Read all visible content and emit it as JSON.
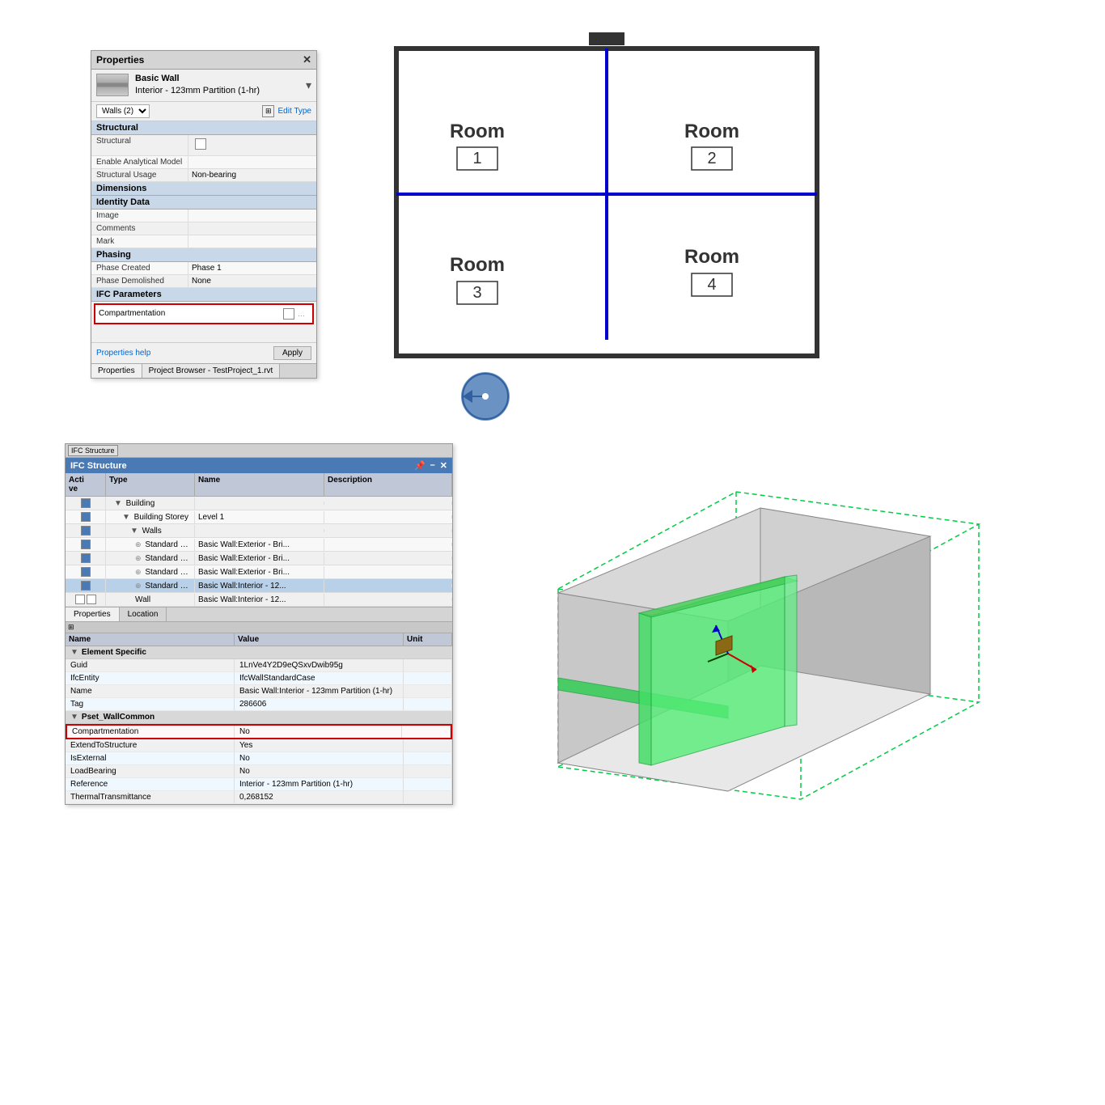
{
  "properties_panel": {
    "title": "Properties",
    "close_btn": "✕",
    "wall_name": "Basic Wall",
    "wall_subtype": "Interior - 123mm Partition (1-hr)",
    "walls_label": "Walls (2)",
    "edit_type_label": "Edit Type",
    "sections": {
      "structural": {
        "header": "Structural",
        "rows": [
          {
            "name": "Structural",
            "value": "checkbox"
          },
          {
            "name": "Enable Analytical Model",
            "value": ""
          },
          {
            "name": "Structural Usage",
            "value": "Non-bearing"
          }
        ]
      },
      "dimensions": {
        "header": "Dimensions"
      },
      "identity_data": {
        "header": "Identity Data",
        "rows": [
          {
            "name": "Image",
            "value": ""
          },
          {
            "name": "Comments",
            "value": ""
          },
          {
            "name": "Mark",
            "value": ""
          }
        ]
      },
      "phasing": {
        "header": "Phasing",
        "rows": [
          {
            "name": "Phase Created",
            "value": "Phase 1"
          },
          {
            "name": "Phase Demolished",
            "value": "None"
          }
        ]
      },
      "ifc_parameters": {
        "header": "IFC Parameters",
        "rows": [
          {
            "name": "Compartmentation",
            "value": "checkbox",
            "highlighted": true
          }
        ]
      }
    },
    "footer": {
      "help_link": "Properties help",
      "apply_btn": "Apply"
    },
    "tabs": [
      "Properties",
      "Project Browser - TestProject_1.rvt"
    ]
  },
  "floor_plan": {
    "rooms": [
      {
        "label": "Room",
        "number": "1"
      },
      {
        "label": "Room",
        "number": "2"
      },
      {
        "label": "Room",
        "number": "3"
      },
      {
        "label": "Room",
        "number": "4"
      }
    ]
  },
  "ifc_structure": {
    "title": "IFC Structure",
    "panel_label": "IFC Structure",
    "table_headers": [
      "Active",
      "Type",
      "Name",
      "Description"
    ],
    "rows": [
      {
        "active": true,
        "indent": 0,
        "type": "Building",
        "name": "",
        "description": ""
      },
      {
        "active": true,
        "indent": 1,
        "type": "Building Storey",
        "name": "Level 1",
        "description": ""
      },
      {
        "active": true,
        "indent": 2,
        "type": "Walls",
        "name": "",
        "description": ""
      },
      {
        "active": true,
        "indent": 3,
        "type": "Standard Wall",
        "name": "Basic Wall:Exterior - Bri...",
        "description": ""
      },
      {
        "active": true,
        "indent": 3,
        "type": "Standard Wall",
        "name": "Basic Wall:Exterior - Bri...",
        "description": ""
      },
      {
        "active": true,
        "indent": 3,
        "type": "Standard Wall",
        "name": "Basic Wall:Exterior - Bri...",
        "description": ""
      },
      {
        "active": true,
        "indent": 3,
        "type": "Standard Wall",
        "name": "Basic Wall:Interior - 12...",
        "description": "",
        "selected": true
      },
      {
        "active": true,
        "indent": 3,
        "type": "Wall",
        "name": "Basic Wall:Interior - 12...",
        "description": ""
      }
    ],
    "bottom_tabs": [
      "Properties",
      "Location"
    ],
    "props_headers": [
      "Name",
      "Value",
      "Unit"
    ],
    "prop_sections": [
      {
        "name": "Element Specific",
        "rows": [
          {
            "name": "Guid",
            "value": "1LnVe4Y2D9eQSxvDwib95g",
            "unit": ""
          },
          {
            "name": "IfcEntity",
            "value": "IfcWallStandardCase",
            "unit": ""
          },
          {
            "name": "Name",
            "value": "Basic Wall:Interior - 123mm Partition (1-hr)",
            "unit": ""
          },
          {
            "name": "Tag",
            "value": "286606",
            "unit": ""
          }
        ]
      },
      {
        "name": "Pset_WallCommon",
        "rows": [
          {
            "name": "Compartmentation",
            "value": "No",
            "unit": "",
            "highlighted": true
          },
          {
            "name": "ExtendToStructure",
            "value": "Yes",
            "unit": ""
          },
          {
            "name": "IsExternal",
            "value": "No",
            "unit": ""
          },
          {
            "name": "LoadBearing",
            "value": "No",
            "unit": ""
          },
          {
            "name": "Reference",
            "value": "Interior - 123mm Partition (1-hr)",
            "unit": ""
          },
          {
            "name": "ThermalTransmittance",
            "value": "0,268152",
            "unit": ""
          }
        ]
      }
    ]
  },
  "colors": {
    "blue_wall": "#0000cc",
    "ifc_titlebar": "#4a7ab5",
    "highlight_red": "#cc0000",
    "green_3d": "#00cc44",
    "room_border": "#333333"
  }
}
